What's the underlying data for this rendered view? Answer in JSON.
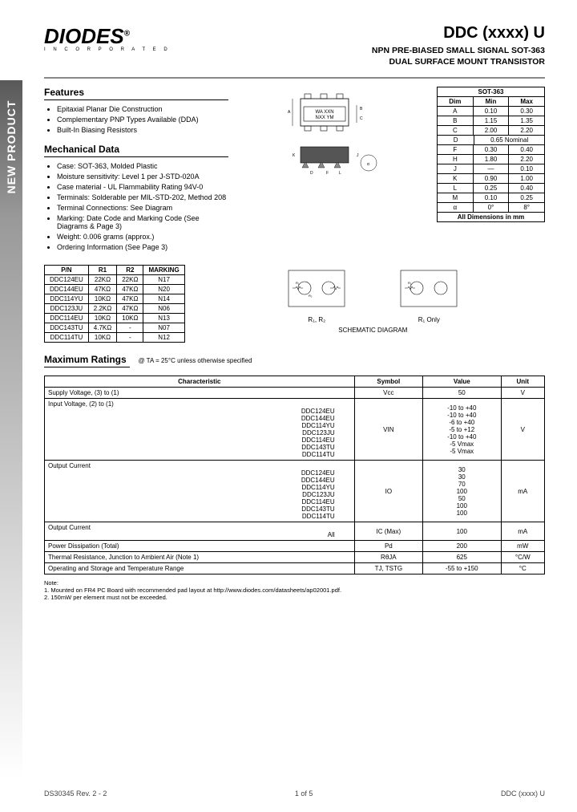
{
  "logo": {
    "main": "DIODES",
    "sub": "I N C O R P O R A T E D",
    "reg": "®"
  },
  "title": {
    "main": "DDC (xxxx) U",
    "sub1": "NPN PRE-BIASED SMALL SIGNAL SOT-363",
    "sub2": "DUAL SURFACE MOUNT TRANSISTOR"
  },
  "side_tab": "NEW PRODUCT",
  "features": {
    "heading": "Features",
    "items": [
      "Epitaxial Planar Die Construction",
      "Complementary PNP Types Available (DDA)",
      "Built-In Biasing Resistors"
    ]
  },
  "mech": {
    "heading": "Mechanical Data",
    "items": [
      "Case: SOT-363, Molded Plastic",
      "Moisture sensitivity: Level 1 per J-STD-020A",
      "Case material - UL Flammability Rating 94V-0",
      "Terminals: Solderable per MIL-STD-202, Method 208",
      "Terminal Connections: See Diagram",
      "Marking: Date Code and Marking Code (See Diagrams & Page 3)",
      "Weight: 0.006 grams (approx.)",
      "Ordering Information (See Page 3)"
    ]
  },
  "marking_box": {
    "line1": "WA XXN",
    "line2": "NXX YM"
  },
  "dim_table": {
    "title": "SOT-363",
    "cols": [
      "Dim",
      "Min",
      "Max"
    ],
    "rows": [
      [
        "A",
        "0.10",
        "0.30"
      ],
      [
        "B",
        "1.15",
        "1.35"
      ],
      [
        "C",
        "2.00",
        "2.20"
      ],
      [
        "D",
        "",
        "0.65 Nominal"
      ],
      [
        "F",
        "0.30",
        "0.40"
      ],
      [
        "H",
        "1.80",
        "2.20"
      ],
      [
        "J",
        "—",
        "0.10"
      ],
      [
        "K",
        "0.90",
        "1.00"
      ],
      [
        "L",
        "0.25",
        "0.40"
      ],
      [
        "M",
        "0.10",
        "0.25"
      ],
      [
        "α",
        "0°",
        "8°"
      ]
    ],
    "footer": "All Dimensions in mm"
  },
  "pn_table": {
    "cols": [
      "P/N",
      "R1",
      "R2",
      "MARKING"
    ],
    "rows": [
      [
        "DDC124EU",
        "22KΩ",
        "22KΩ",
        "N17"
      ],
      [
        "DDC144EU",
        "47KΩ",
        "47KΩ",
        "N20"
      ],
      [
        "DDC114YU",
        "10KΩ",
        "47KΩ",
        "N14"
      ],
      [
        "DDC123JU",
        "2.2KΩ",
        "47KΩ",
        "N06"
      ],
      [
        "DDC114EU",
        "10KΩ",
        "10KΩ",
        "N13"
      ],
      [
        "DDC143TU",
        "4.7KΩ",
        "-",
        "N07"
      ],
      [
        "DDC114TU",
        "10KΩ",
        "-",
        "N12"
      ]
    ]
  },
  "schematic": {
    "left_label": "R₁, R₂",
    "right_label": "R₁ Only",
    "caption": "SCHEMATIC DIAGRAM"
  },
  "max_ratings": {
    "heading": "Maximum Ratings",
    "cond": "@ TA = 25°C unless otherwise specified",
    "cols": [
      "Characteristic",
      "Symbol",
      "Value",
      "Unit"
    ],
    "rows": [
      {
        "char": "Supply Voltage, (3) to (1)",
        "sym": "Vcc",
        "val": "50",
        "unit": "V"
      },
      {
        "char": "Input Voltage, (2) to (1)",
        "parts": "DDC124EU\nDDC144EU\nDDC114YU\nDDC123JU\nDDC114EU\nDDC143TU\nDDC114TU",
        "sym": "VIN",
        "val": "-10 to +40\n-10 to +40\n-6 to +40\n-5 to +12\n-10 to +40\n-5 Vmax\n-5 Vmax",
        "unit": "V"
      },
      {
        "char": "Output Current",
        "parts": "DDC124EU\nDDC144EU\nDDC114YU\nDDC123JU\nDDC114EU\nDDC143TU\nDDC114TU",
        "sym": "IO",
        "val": "30\n30\n70\n100\n50\n100\n100",
        "unit": "mA"
      },
      {
        "char": "Output Current",
        "parts": "All",
        "sym": "IC (Max)",
        "val": "100",
        "unit": "mA"
      },
      {
        "char": "Power Dissipation (Total)",
        "sym": "Pd",
        "val": "200",
        "unit": "mW"
      },
      {
        "char": "Thermal Resistance, Junction to Ambient Air (Note 1)",
        "sym": "RθJA",
        "val": "625",
        "unit": "°C/W"
      },
      {
        "char": "Operating and Storage and Temperature Range",
        "sym": "TJ, TSTG",
        "val": "-55 to +150",
        "unit": "°C"
      }
    ]
  },
  "notes": {
    "label": "Note:",
    "items": [
      "1. Mounted on FR4 PC Board with recommended pad layout at http://www.diodes.com/datasheets/ap02001.pdf.",
      "2. 150mW per element must not be exceeded."
    ]
  },
  "footer": {
    "left": "DS30345 Rev. 2 - 2",
    "center": "1 of 5",
    "right": "DDC (xxxx) U"
  }
}
